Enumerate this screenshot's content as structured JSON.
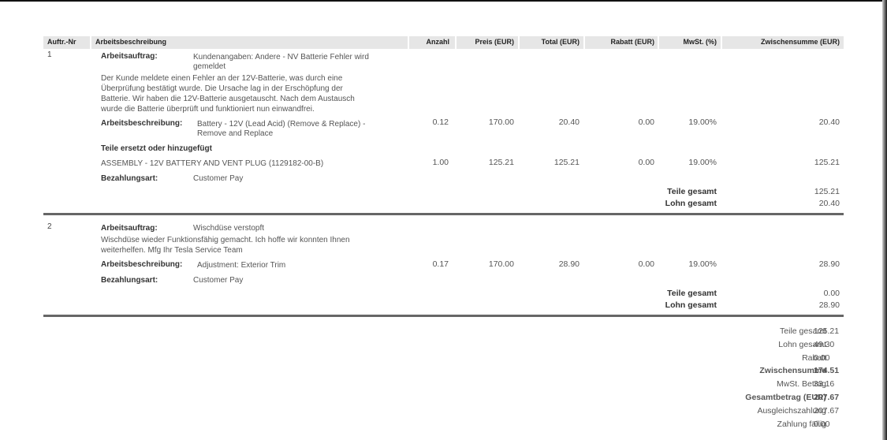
{
  "header": {
    "auftr_nr": "Auftr.-Nr",
    "beschreibung": "Arbeitsbeschreibung",
    "anzahl": "Anzahl",
    "preis": "Preis (EUR)",
    "total": "Total (EUR)",
    "rabatt": "Rabatt (EUR)",
    "mwst": "MwSt. (%)",
    "zwischensumme": "Zwischensumme (EUR)"
  },
  "orders": [
    {
      "nr": "1",
      "auftrag_label": "Arbeitsauftrag:",
      "auftrag_value_1": "Kundenangaben: Andere - NV Batterie Fehler wird",
      "auftrag_value_2": "gemeldet",
      "desc_1": "Der Kunde meldete einen Fehler an der 12V-Batterie, was durch eine",
      "desc_2": "Überprüfung bestätigt wurde. Die Ursache lag in der Erschöpfung der",
      "desc_3": "Batterie. Wir haben die 12V-Batterie ausgetauscht. Nach dem Austausch",
      "desc_4": "wurde die Batterie überprüft und funktioniert nun einwandfrei.",
      "arbeit_label": "Arbeitsbeschreibung:",
      "arbeit_value_1": "Battery - 12V (Lead Acid) (Remove & Replace) -",
      "arbeit_value_2": "Remove and Replace",
      "arbeit_anzahl": "0.12",
      "arbeit_preis": "170.00",
      "arbeit_total": "20.40",
      "arbeit_rabatt": "0.00",
      "arbeit_mwst": "19.00%",
      "arbeit_zws": "20.40",
      "teile_heading": "Teile ersetzt oder hinzugefügt",
      "teil_name": "ASSEMBLY - 12V BATTERY AND VENT PLUG (1129182-00-B)",
      "teil_anzahl": "1.00",
      "teil_preis": "125.21",
      "teil_total": "125.21",
      "teil_rabatt": "0.00",
      "teil_mwst": "19.00%",
      "teil_zws": "125.21",
      "zahl_label": "Bezahlungsart:",
      "zahl_value": "Customer Pay",
      "teile_gesamt_label": "Teile gesamt",
      "teile_gesamt": "125.21",
      "lohn_gesamt_label": "Lohn gesamt",
      "lohn_gesamt": "20.40"
    },
    {
      "nr": "2",
      "auftrag_label": "Arbeitsauftrag:",
      "auftrag_value_1": "Wischdüse verstopft",
      "desc_1": "Wischdüse wieder Funktionsfähig gemacht. Ich hoffe wir konnten Ihnen",
      "desc_2": "weiterhelfen. Mfg Ihr Tesla Service Team",
      "arbeit_label": "Arbeitsbeschreibung:",
      "arbeit_value_1": "Adjustment: Exterior Trim",
      "arbeit_anzahl": "0.17",
      "arbeit_preis": "170.00",
      "arbeit_total": "28.90",
      "arbeit_rabatt": "0.00",
      "arbeit_mwst": "19.00%",
      "arbeit_zws": "28.90",
      "zahl_label": "Bezahlungsart:",
      "zahl_value": "Customer Pay",
      "teile_gesamt_label": "Teile gesamt",
      "teile_gesamt": "0.00",
      "lohn_gesamt_label": "Lohn gesamt",
      "lohn_gesamt": "28.90"
    }
  ],
  "summary": [
    {
      "label": "Teile gesamt",
      "value": "125.21",
      "bold": false
    },
    {
      "label": "Lohn gesamt",
      "value": "49.30",
      "bold": false
    },
    {
      "label": "Rabatt",
      "value": "0.00",
      "bold": false
    },
    {
      "label": "Zwischensumme",
      "value": "174.51",
      "bold": true
    },
    {
      "label": "MwSt. Betrag",
      "value": "33.16",
      "bold": false
    },
    {
      "label": "Gesamtbetrag (EUR)",
      "value": "207.67",
      "bold": true
    },
    {
      "label": "Ausgleichszahlung",
      "value": "207.67",
      "bold": false
    },
    {
      "label": "Zahlung fällig",
      "value": "0.00",
      "bold": false
    }
  ]
}
